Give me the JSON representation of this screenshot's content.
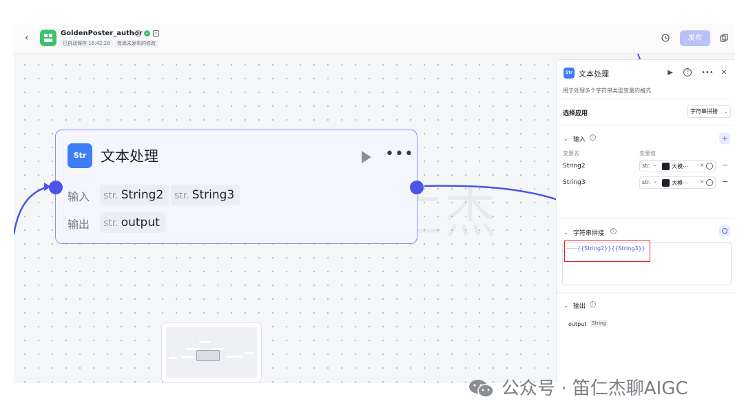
{
  "header": {
    "back_icon": "chevron-left-icon",
    "app_name": "GoldenPoster_author",
    "autosave_chip": "已自动保存 16:42:28",
    "unpublished_chip": "有尚未发布的修改",
    "publish_label": "发布",
    "history_icon": "history-icon",
    "copy_icon": "copy-icon"
  },
  "node": {
    "icon_text": "Str",
    "title": "文本处理",
    "input_label": "输入",
    "output_label": "输出",
    "inputs": [
      {
        "type": "str.",
        "name": "String2"
      },
      {
        "type": "str.",
        "name": "String3"
      }
    ],
    "outputs": [
      {
        "type": "str.",
        "name": "output"
      }
    ],
    "border_color": "#8c8df2",
    "port_color": "#4a55e8"
  },
  "panel": {
    "title": "文本处理",
    "description": "用于处理多个字符串类型变量的格式",
    "select_app_label": "选择应用",
    "select_app_value": "字符串拼接",
    "input_section": "输入",
    "col_var_name": "变量名",
    "col_var_value": "变量值",
    "variables": [
      {
        "name": "String2",
        "type": "str.",
        "ref": "大模⋯",
        "ref_dot": "·"
      },
      {
        "name": "String3",
        "type": "str.",
        "ref": "大模⋯",
        "ref_dot": "·"
      }
    ],
    "concat_section": "字符串拼接",
    "concat_line_number": "——",
    "concat_expression": "{{String2}}{{String3}}",
    "output_section": "输出",
    "output_name": "output",
    "output_type": "String",
    "accent_color": "#4a55e8",
    "highlight_color": "#e02020"
  },
  "watermarks": {
    "big": "原创内容BY笛仁杰",
    "wechat": "公众号 · 笛仁杰聊AIGC"
  }
}
